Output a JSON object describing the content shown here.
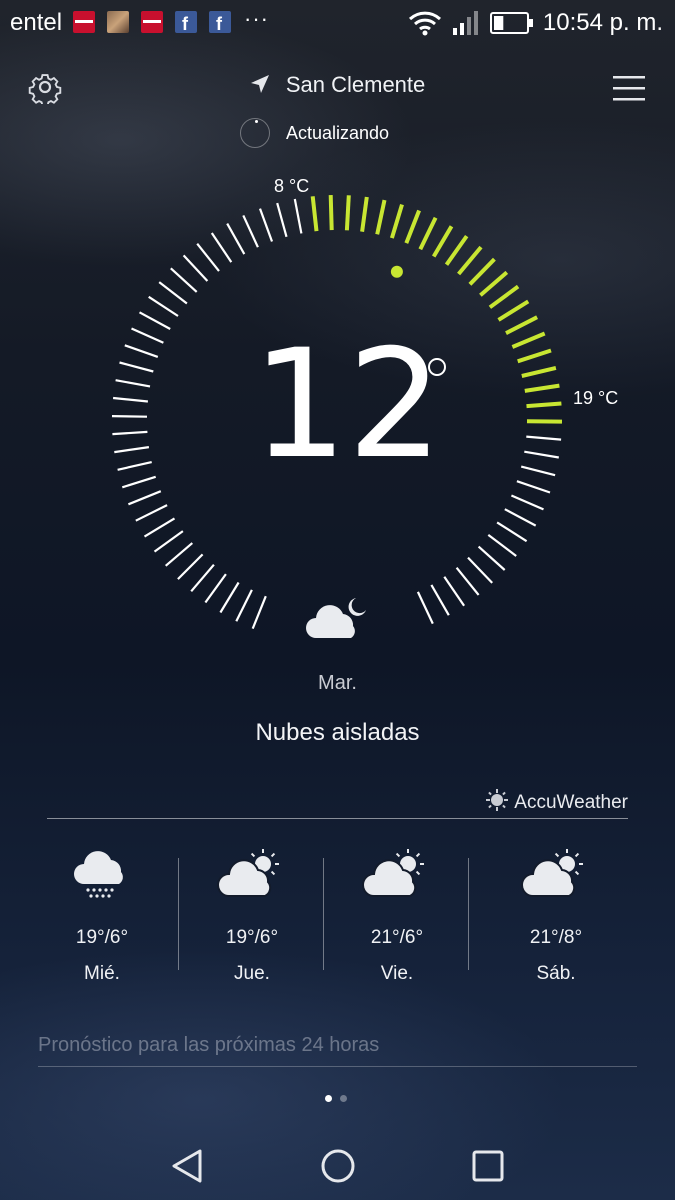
{
  "status_bar": {
    "carrier": "entel",
    "overflow": "···",
    "time": "10:54 p. m.",
    "notification_icons": [
      "futura-app-icon",
      "photo-app-icon",
      "futura-app-icon",
      "facebook-icon",
      "facebook-icon"
    ],
    "battery_level": 0.3
  },
  "header": {
    "location": "San Clemente",
    "status": "Actualizando"
  },
  "current": {
    "temperature": "12",
    "min_label": "8 °C",
    "max_label": "19 °C",
    "day": "Mar.",
    "condition": "Nubes aisladas",
    "icon": "cloud-moon-icon"
  },
  "provider": "AccuWeather",
  "forecast": [
    {
      "day": "Mié.",
      "temps": "19°/6°",
      "icon": "rain-cloud-icon"
    },
    {
      "day": "Jue.",
      "temps": "19°/6°",
      "icon": "partly-cloudy-icon"
    },
    {
      "day": "Vie.",
      "temps": "21°/6°",
      "icon": "partly-cloudy-icon"
    },
    {
      "day": "Sáb.",
      "temps": "21°/8°",
      "icon": "partly-cloudy-icon"
    }
  ],
  "hourly_link": "Pronóstico para las próximas 24 horas",
  "pager": {
    "count": 2,
    "active": 0
  },
  "colors": {
    "accent": "#c8e632",
    "tick": "#ffffff"
  }
}
